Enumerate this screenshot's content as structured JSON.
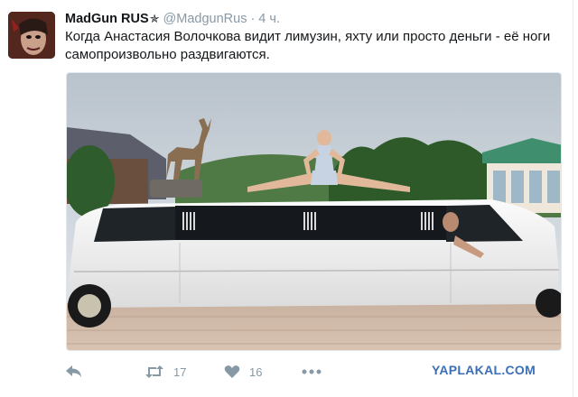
{
  "tweet": {
    "display_name": "MadGun RUS",
    "verified_symbol": "✯",
    "handle": "@MadgunRus",
    "separator": "·",
    "time": "4 ч.",
    "text": "Когда Анастасия Волочкова видит лимузин, яхту или просто деньги - её ноги самопроизвольно раздвигаются."
  },
  "actions": {
    "reply_icon": "reply-icon",
    "retweet_icon": "retweet-icon",
    "retweet_count": "17",
    "like_icon": "heart-icon",
    "like_count": "16",
    "more_icon": "more-icon"
  },
  "watermark": "YAPLAKAL.COM",
  "colors": {
    "muted": "#8899a6",
    "text": "#14171a",
    "watermark": "#3b6fb6"
  }
}
